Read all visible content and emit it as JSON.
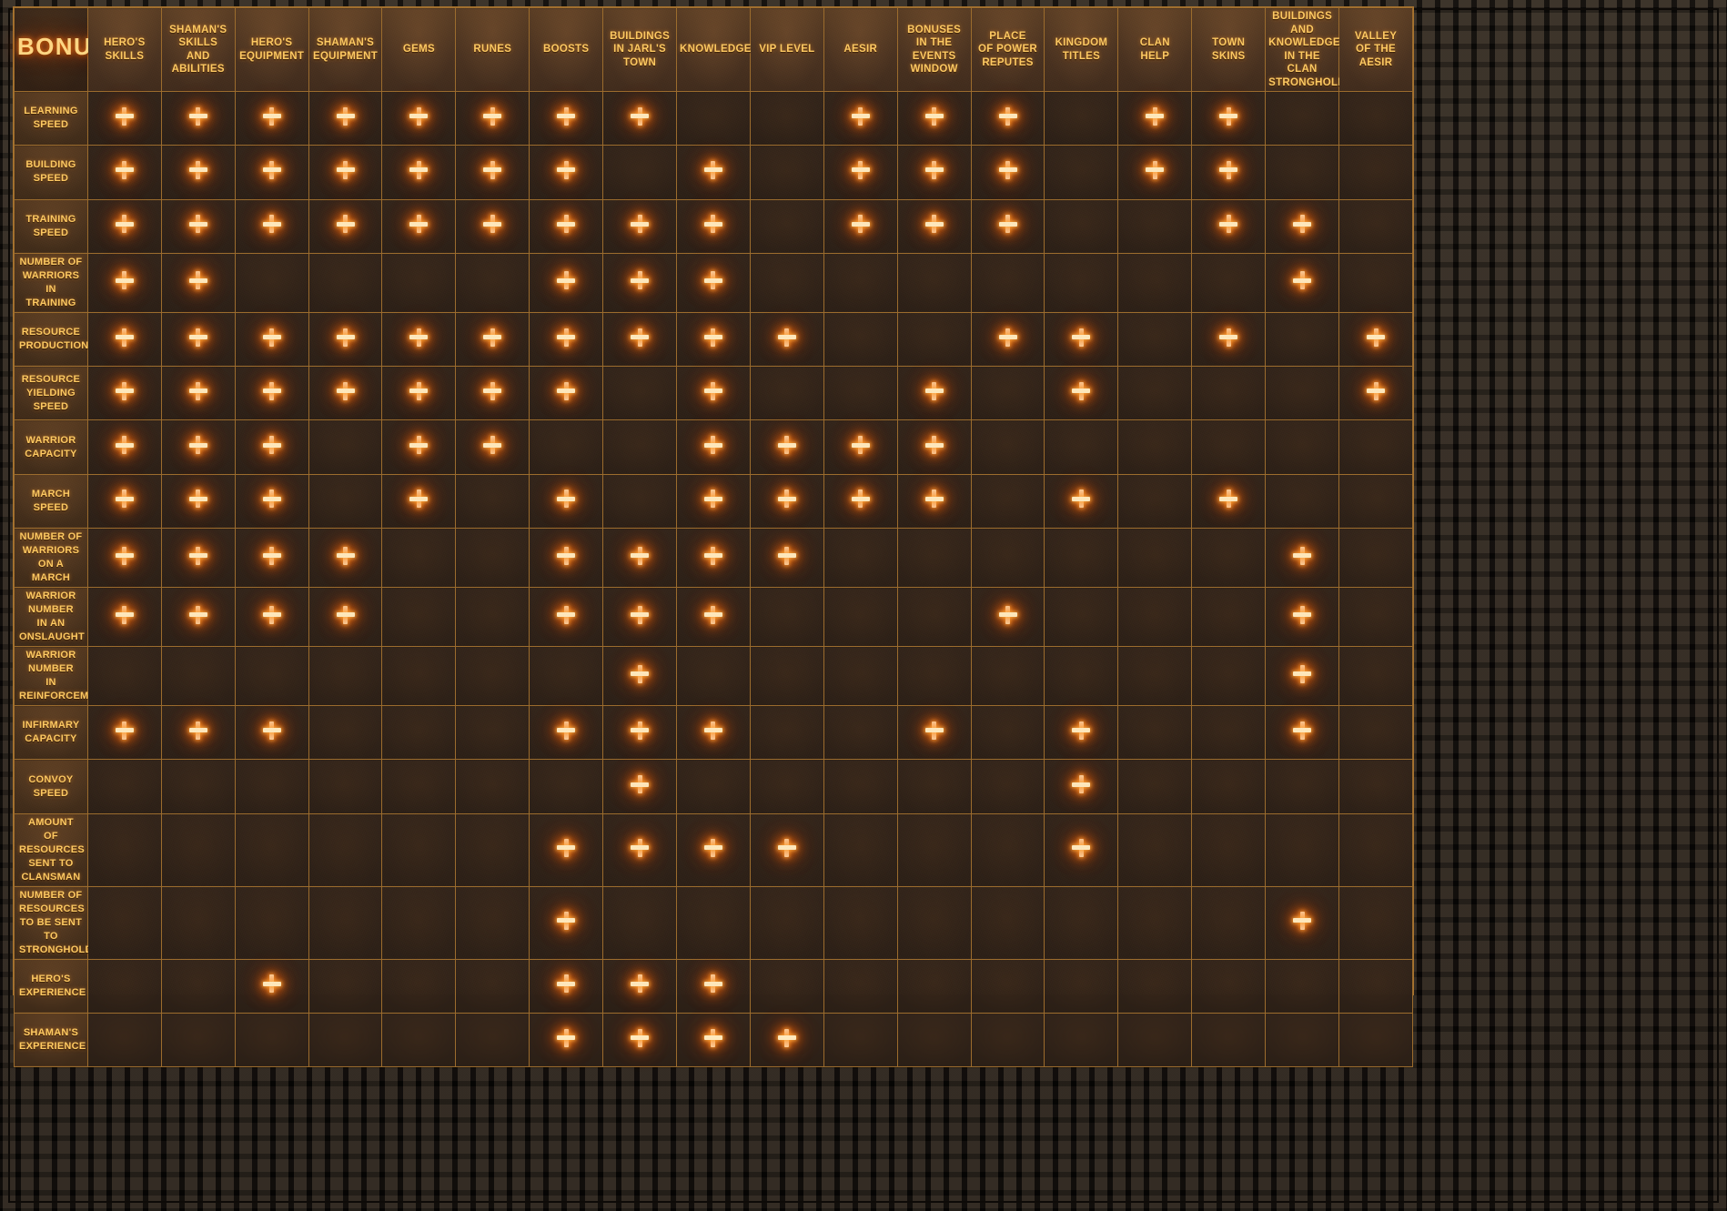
{
  "panel": {
    "title": "BONUSES",
    "accent_color": "#ffcb63",
    "glow_color": "#ff7814",
    "border_color": "#a9742f",
    "background_color": "#34251a"
  },
  "columns": [
    "HERO'S\nSKILLS",
    "SHAMAN'S\nSKILLS\nAND ABILITIES",
    "HERO'S\nEQUIPMENT",
    "SHAMAN'S\nEQUIPMENT",
    "GEMS",
    "RUNES",
    "BOOSTS",
    "BUILDINGS\nIN JARL'S\nTOWN",
    "KNOWLEDGE",
    "VIP LEVEL",
    "AESIR",
    "BONUSES\nIN THE EVENTS\nWINDOW",
    "PLACE\nOF POWER\nREPUTES",
    "KINGDOM\nTITLES",
    "CLAN\nHELP",
    "TOWN\nSKINS",
    "BUILDINGS AND\nKNOWLEDGE\nIN THE CLAN\nSTRONGHOLD",
    "VALLEY\nOF THE AESIR"
  ],
  "rows": [
    {
      "label": "LEARNING\nSPEED",
      "marks": [
        1,
        1,
        1,
        1,
        1,
        1,
        1,
        1,
        0,
        0,
        1,
        1,
        1,
        0,
        1,
        1,
        0,
        0
      ]
    },
    {
      "label": "BUILDING\nSPEED",
      "marks": [
        1,
        1,
        1,
        1,
        1,
        1,
        1,
        0,
        1,
        0,
        1,
        1,
        1,
        0,
        1,
        1,
        0,
        0
      ]
    },
    {
      "label": "TRAINING\nSPEED",
      "marks": [
        1,
        1,
        1,
        1,
        1,
        1,
        1,
        1,
        1,
        0,
        1,
        1,
        1,
        0,
        0,
        1,
        1,
        0
      ]
    },
    {
      "label": "NUMBER OF WARRIORS\nIN TRAINING",
      "marks": [
        1,
        1,
        0,
        0,
        0,
        0,
        1,
        1,
        1,
        0,
        0,
        0,
        0,
        0,
        0,
        0,
        1,
        0
      ]
    },
    {
      "label": "RESOURCE\nPRODUCTION",
      "marks": [
        1,
        1,
        1,
        1,
        1,
        1,
        1,
        1,
        1,
        1,
        0,
        0,
        1,
        1,
        0,
        1,
        0,
        1
      ]
    },
    {
      "label": "RESOURCE\nYIELDING SPEED",
      "marks": [
        1,
        1,
        1,
        1,
        1,
        1,
        1,
        0,
        1,
        0,
        0,
        1,
        0,
        1,
        0,
        0,
        0,
        1
      ]
    },
    {
      "label": "WARRIOR CAPACITY",
      "marks": [
        1,
        1,
        1,
        0,
        1,
        1,
        0,
        0,
        1,
        1,
        1,
        1,
        0,
        0,
        0,
        0,
        0,
        0
      ]
    },
    {
      "label": "MARCH SPEED",
      "marks": [
        1,
        1,
        1,
        0,
        1,
        0,
        1,
        0,
        1,
        1,
        1,
        1,
        0,
        1,
        0,
        1,
        0,
        0
      ]
    },
    {
      "label": "NUMBER OF WARRIORS\nON A MARCH",
      "marks": [
        1,
        1,
        1,
        1,
        0,
        0,
        1,
        1,
        1,
        1,
        0,
        0,
        0,
        0,
        0,
        0,
        1,
        0
      ]
    },
    {
      "label": "WARRIOR NUMBER\nIN AN ONSLAUGHT",
      "marks": [
        1,
        1,
        1,
        1,
        0,
        0,
        1,
        1,
        1,
        0,
        0,
        0,
        1,
        0,
        0,
        0,
        1,
        0
      ]
    },
    {
      "label": "WARRIOR NUMBER\nIN REINFORCEMENTS",
      "marks": [
        0,
        0,
        0,
        0,
        0,
        0,
        0,
        1,
        0,
        0,
        0,
        0,
        0,
        0,
        0,
        0,
        1,
        0
      ]
    },
    {
      "label": "INFIRMARY\nCAPACITY",
      "marks": [
        1,
        1,
        1,
        0,
        0,
        0,
        1,
        1,
        1,
        0,
        0,
        1,
        0,
        1,
        0,
        0,
        1,
        0
      ]
    },
    {
      "label": "CONVOY\nSPEED",
      "marks": [
        0,
        0,
        0,
        0,
        0,
        0,
        0,
        1,
        0,
        0,
        0,
        0,
        0,
        1,
        0,
        0,
        0,
        0
      ]
    },
    {
      "label": "AMOUNT\nOF RESOURCES\nSENT TO CLANSMAN",
      "marks": [
        0,
        0,
        0,
        0,
        0,
        0,
        1,
        1,
        1,
        1,
        0,
        0,
        0,
        1,
        0,
        0,
        0,
        0
      ]
    },
    {
      "label": "NUMBER OF\nRESOURCES TO BE SENT\nTO STRONGHOLD",
      "marks": [
        0,
        0,
        0,
        0,
        0,
        0,
        1,
        0,
        0,
        0,
        0,
        0,
        0,
        0,
        0,
        0,
        1,
        0
      ]
    },
    {
      "label": "HERO'S EXPERIENCE",
      "marks": [
        0,
        0,
        1,
        0,
        0,
        0,
        1,
        1,
        1,
        0,
        0,
        0,
        0,
        0,
        0,
        0,
        0,
        0
      ]
    },
    {
      "label": "SHAMAN'S EXPERIENCE",
      "marks": [
        0,
        0,
        0,
        0,
        0,
        0,
        1,
        1,
        1,
        1,
        0,
        0,
        0,
        0,
        0,
        0,
        0,
        0
      ]
    }
  ]
}
